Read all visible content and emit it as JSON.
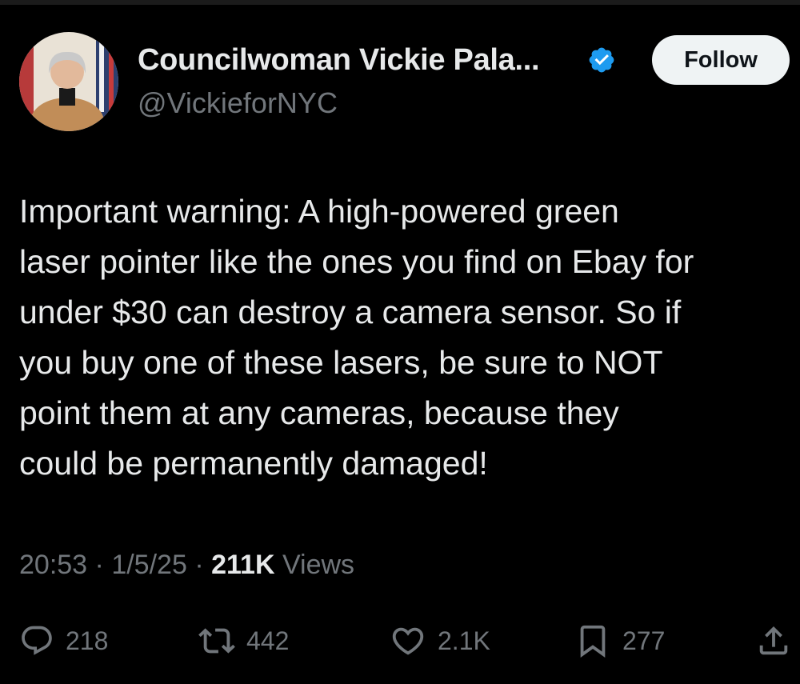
{
  "author": {
    "display_name": "Councilwoman Vickie Pala...",
    "handle": "@VickieforNYC",
    "verified": true,
    "avatar_icon": "profile-photo"
  },
  "follow_button": {
    "label": "Follow"
  },
  "tweet": {
    "text": "Important warning: A high-powered green\nlaser pointer like the ones you find on Ebay for\nunder $30 can destroy a camera sensor. So if\nyou buy one of these lasers, be sure to NOT\npoint them at any cameras, because they\ncould be permanently damaged!",
    "time": "20:53",
    "separator": "·",
    "date": "1/5/25",
    "views_count": "211K",
    "views_label": "Views"
  },
  "actions": {
    "replies": {
      "icon": "reply-icon",
      "count": "218"
    },
    "reposts": {
      "icon": "repost-icon",
      "count": "442"
    },
    "likes": {
      "icon": "heart-icon",
      "count": "2.1K"
    },
    "bookmarks": {
      "icon": "bookmark-icon",
      "count": "277"
    },
    "share": {
      "icon": "share-icon"
    }
  },
  "colors": {
    "background": "#000000",
    "primary_text": "#e7e9ea",
    "secondary_text": "#71767b",
    "verified_blue": "#1d9bf0",
    "follow_button_bg": "#eff3f4"
  }
}
